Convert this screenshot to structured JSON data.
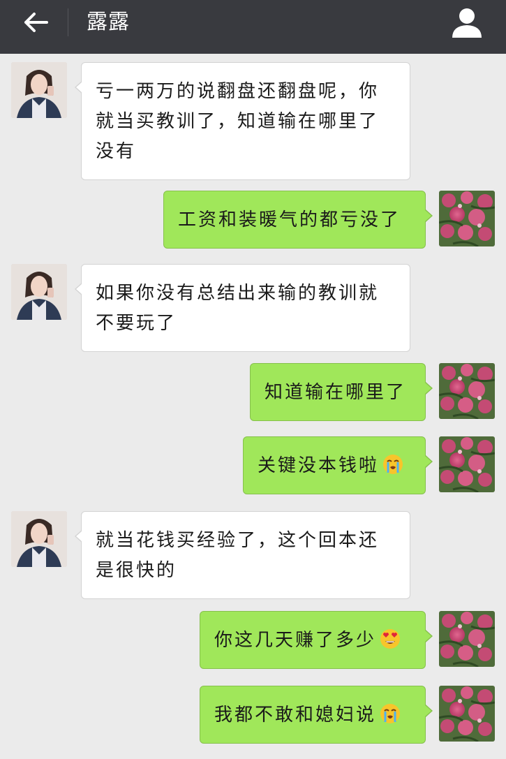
{
  "header": {
    "title": "露露",
    "back_icon": "arrow-left-icon",
    "profile_icon": "person-icon",
    "background": "#393a3f"
  },
  "colors": {
    "chat_background": "#ebebeb",
    "outgoing_bubble": "#a0e75a",
    "incoming_bubble": "#ffffff"
  },
  "messages": [
    {
      "side": "left",
      "text": "亏一两万的说翻盘还翻盘呢，你就当买教训了，知道输在哪里了没有"
    },
    {
      "side": "right",
      "text": "工资和装暖气的都亏没了"
    },
    {
      "side": "left",
      "text": "如果你没有总结出来输的教训就不要玩了"
    },
    {
      "side": "right",
      "text": "知道输在哪里了"
    },
    {
      "side": "right",
      "text": "关键没本钱啦",
      "emoji": "crying-face-icon"
    },
    {
      "side": "left",
      "text": "就当花钱买经验了，这个回本还是很快的"
    },
    {
      "side": "right",
      "text": "你这几天赚了多少",
      "emoji": "heart-eyes-face-icon"
    },
    {
      "side": "right",
      "text": "我都不敢和媳妇说",
      "emoji": "crying-face-icon"
    }
  ]
}
